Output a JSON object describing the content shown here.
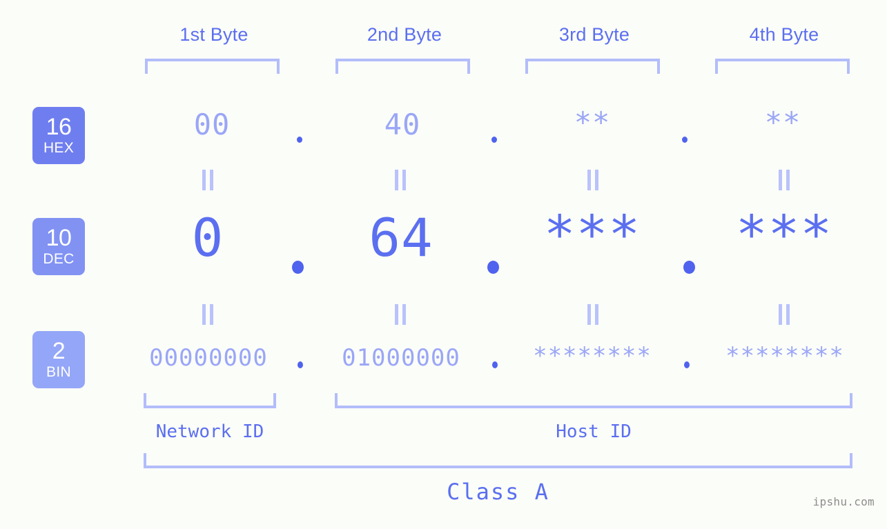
{
  "background_color": "#fbfdf8",
  "accent_color": "#5b6ff0",
  "muted_color": "#9aa6f7",
  "bracket_color": "#b3bdfb",
  "byte_headers": [
    {
      "label": "1st Byte"
    },
    {
      "label": "2nd Byte"
    },
    {
      "label": "3rd Byte"
    },
    {
      "label": "4th Byte"
    }
  ],
  "rows": [
    {
      "badge_number": "16",
      "badge_abbr": "HEX",
      "badge_color": "#6f7eef",
      "values": [
        "00",
        "40",
        "**",
        "**"
      ]
    },
    {
      "badge_number": "10",
      "badge_abbr": "DEC",
      "badge_color": "#8192f3",
      "values": [
        "0",
        "64",
        "***",
        "***"
      ]
    },
    {
      "badge_number": "2",
      "badge_abbr": "BIN",
      "badge_color": "#94a6f7",
      "values": [
        "00000000",
        "01000000",
        "********",
        "********"
      ]
    }
  ],
  "separator": ".",
  "equals_glyph": "||",
  "id_sections": [
    {
      "label": "Network ID"
    },
    {
      "label": "Host ID"
    }
  ],
  "class_label": "Class A",
  "watermark": "ipshu.com"
}
